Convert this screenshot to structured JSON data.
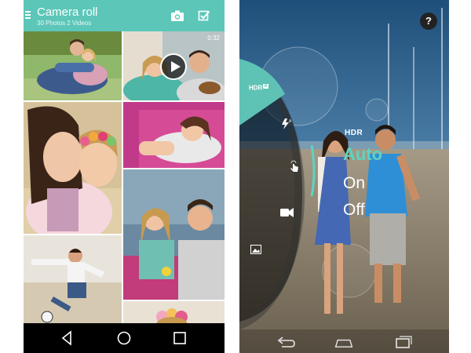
{
  "gallery": {
    "title": "Camera roll",
    "subtitle": "30 Photos 2 Videos",
    "video_duration": "0:32",
    "icons": [
      "menu-icon",
      "camera-icon",
      "select-check-icon",
      "play-icon",
      "back-icon",
      "home-icon",
      "recents-icon"
    ],
    "accent_color": "#5cc6b8"
  },
  "camera": {
    "help_label": "?",
    "hdr_label": "HDR",
    "hdr_tab_label": "HDR",
    "hdr_tab_badge": "A",
    "options": [
      "Auto",
      "On",
      "Off"
    ],
    "selected_option": "Auto",
    "accent_color": "#5fd3c3",
    "icons": [
      "help-icon",
      "hdr-icon",
      "flash-auto-icon",
      "touch-focus-icon",
      "video-icon",
      "gallery-icon",
      "back-icon",
      "home-icon",
      "recents-icon"
    ]
  }
}
